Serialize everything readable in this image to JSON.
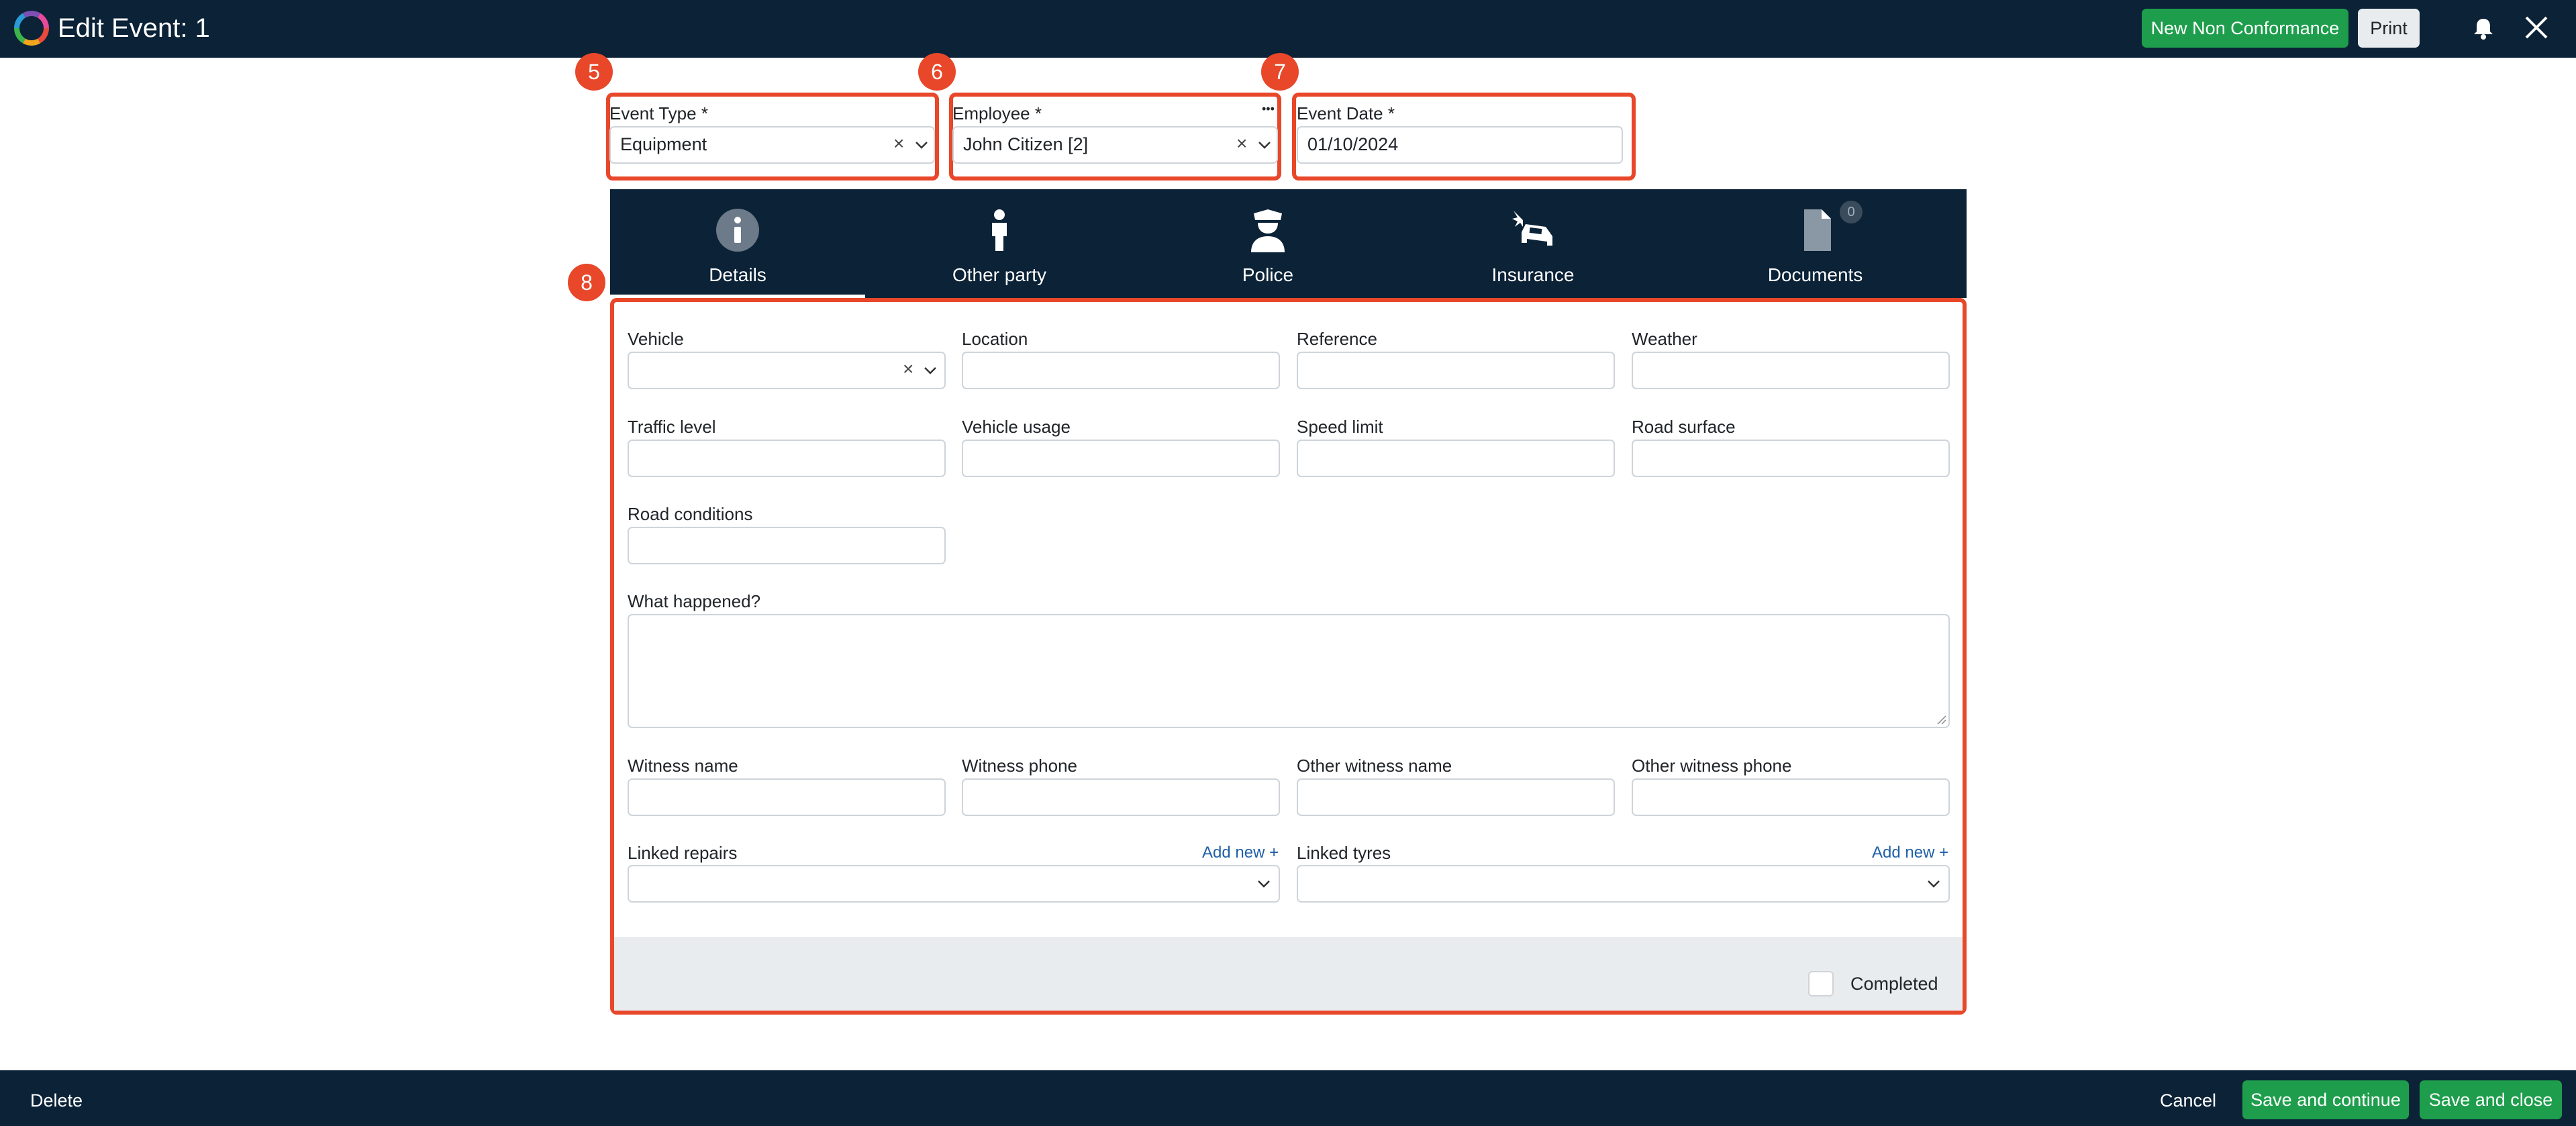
{
  "header": {
    "title": "Edit Event: 1",
    "new_nc_label": "New Non Conformance",
    "print_label": "Print"
  },
  "callouts": [
    "5",
    "6",
    "7",
    "8"
  ],
  "top_fields": {
    "event_type": {
      "label": "Event Type *",
      "value": "Equipment"
    },
    "employee": {
      "label": "Employee *",
      "value": "John Citizen [2]",
      "more": "•••"
    },
    "event_date": {
      "label": "Event Date *",
      "value": "01/10/2024"
    }
  },
  "tabs": [
    {
      "label": "Details",
      "icon": "info-icon",
      "active": true
    },
    {
      "label": "Other party",
      "icon": "person-icon"
    },
    {
      "label": "Police",
      "icon": "police-officer-icon"
    },
    {
      "label": "Insurance",
      "icon": "car-crash-icon"
    },
    {
      "label": "Documents",
      "icon": "document-icon",
      "count": "0"
    }
  ],
  "details": {
    "vehicle": "Vehicle",
    "location": "Location",
    "reference": "Reference",
    "weather": "Weather",
    "traffic_level": "Traffic level",
    "vehicle_usage": "Vehicle usage",
    "speed_limit": "Speed limit",
    "road_surface": "Road surface",
    "road_conditions": "Road conditions",
    "what_happened": "What happened?",
    "witness_name": "Witness name",
    "witness_phone": "Witness phone",
    "other_witness_name": "Other witness name",
    "other_witness_phone": "Other witness phone",
    "linked_repairs": "Linked repairs",
    "linked_tyres": "Linked tyres",
    "add_new": "Add new +",
    "completed": "Completed"
  },
  "footer": {
    "delete_label": "Delete",
    "cancel_label": "Cancel",
    "save_continue_label": "Save and continue",
    "save_close_label": "Save and close"
  },
  "colors": {
    "navy": "#0b2237",
    "green": "#1e9e4c",
    "callout": "#e8472a"
  }
}
